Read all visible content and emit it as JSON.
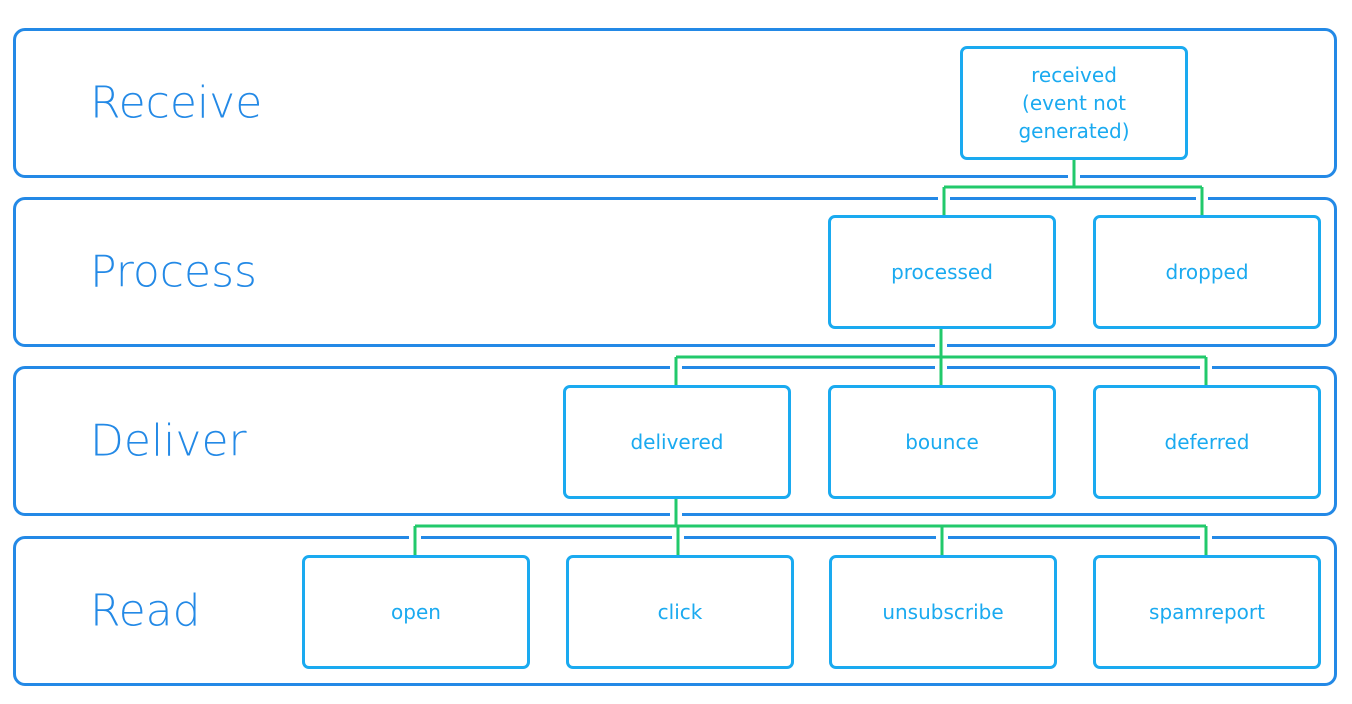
{
  "lanes": [
    "Receive",
    "Process",
    "Deliver",
    "Read"
  ],
  "events": {
    "received": "received (event not generated)",
    "processed": "processed",
    "dropped": "dropped",
    "delivered": "delivered",
    "bounce": "bounce",
    "deferred": "deferred",
    "open": "open",
    "click": "click",
    "unsubscribe": "unsubscribe",
    "spamreport": "spamreport"
  },
  "colors": {
    "lane_border": "#2389e6",
    "event_border": "#1aaaf0",
    "connector": "#22c96b"
  }
}
